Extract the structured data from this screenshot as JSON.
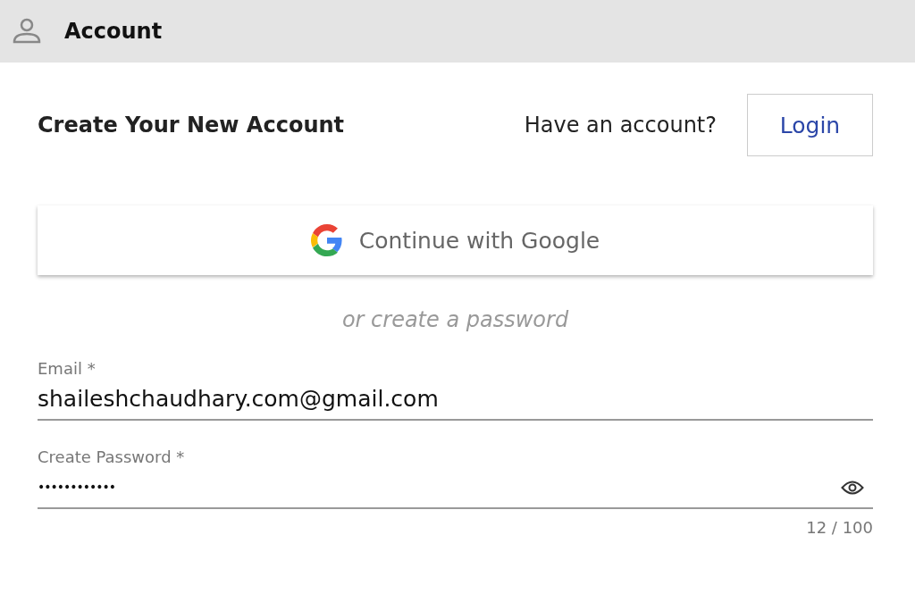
{
  "header": {
    "title": "Account"
  },
  "heading": "Create Your New Account",
  "login_prompt": {
    "text": "Have an account?",
    "button": "Login"
  },
  "google_button": "Continue with Google",
  "divider_text": "or create a password",
  "fields": [
    {
      "label": "Email *",
      "value": "shaileshchaudhary.com@gmail.com",
      "kind": "text"
    },
    {
      "label": "Create Password *",
      "value": "••••••••••••",
      "kind": "password",
      "counter": "12 / 100"
    }
  ]
}
